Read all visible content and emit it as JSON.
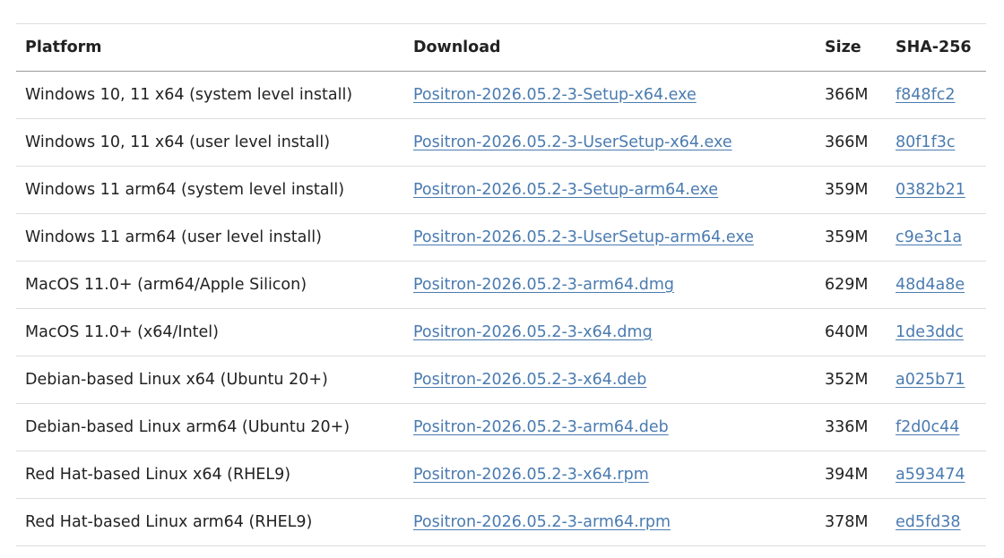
{
  "headers": {
    "platform": "Platform",
    "download": "Download",
    "size": "Size",
    "sha": "SHA-256"
  },
  "link_color": "#4a7bb0",
  "rows": [
    {
      "platform": "Windows 10, 11 x64 (system level install)",
      "file": "Positron-2026.05.2-3-Setup-x64.exe",
      "size": "366M",
      "sha": "f848fc2"
    },
    {
      "platform": "Windows 10, 11 x64 (user level install)",
      "file": "Positron-2026.05.2-3-UserSetup-x64.exe",
      "size": "366M",
      "sha": "80f1f3c"
    },
    {
      "platform": "Windows 11 arm64 (system level install)",
      "file": "Positron-2026.05.2-3-Setup-arm64.exe",
      "size": "359M",
      "sha": "0382b21"
    },
    {
      "platform": "Windows 11 arm64 (user level install)",
      "file": "Positron-2026.05.2-3-UserSetup-arm64.exe",
      "size": "359M",
      "sha": "c9e3c1a"
    },
    {
      "platform": "MacOS 11.0+ (arm64/Apple Silicon)",
      "file": "Positron-2026.05.2-3-arm64.dmg",
      "size": "629M",
      "sha": "48d4a8e"
    },
    {
      "platform": "MacOS 11.0+ (x64/Intel)",
      "file": "Positron-2026.05.2-3-x64.dmg",
      "size": "640M",
      "sha": "1de3ddc"
    },
    {
      "platform": "Debian-based Linux x64 (Ubuntu 20+)",
      "file": "Positron-2026.05.2-3-x64.deb",
      "size": "352M",
      "sha": "a025b71"
    },
    {
      "platform": "Debian-based Linux arm64 (Ubuntu 20+)",
      "file": "Positron-2026.05.2-3-arm64.deb",
      "size": "336M",
      "sha": "f2d0c44"
    },
    {
      "platform": "Red Hat-based Linux x64 (RHEL9)",
      "file": "Positron-2026.05.2-3-x64.rpm",
      "size": "394M",
      "sha": "a593474"
    },
    {
      "platform": "Red Hat-based Linux arm64 (RHEL9)",
      "file": "Positron-2026.05.2-3-arm64.rpm",
      "size": "378M",
      "sha": "ed5fd38"
    }
  ]
}
